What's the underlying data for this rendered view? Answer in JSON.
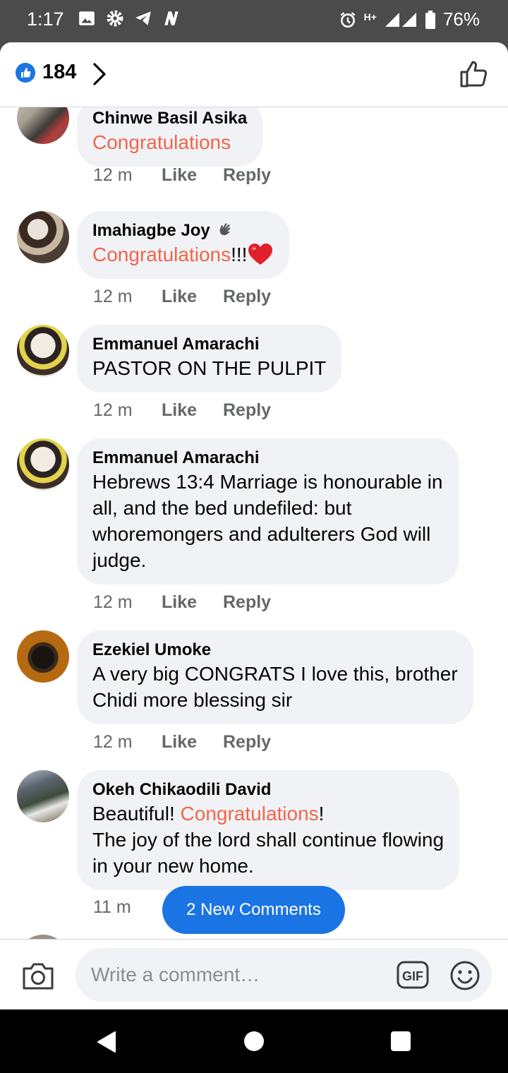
{
  "status_bar": {
    "time": "1:17",
    "network": "H+",
    "battery": "76%",
    "icons": [
      "image-icon",
      "gear-icon",
      "telegram-icon",
      "n-app-icon",
      "alarm-icon",
      "signal-icon",
      "battery-icon"
    ]
  },
  "header": {
    "reaction_count": "184",
    "icons": [
      "like-reaction-icon",
      "chevron-right-icon",
      "thumbs-up-outline-icon"
    ]
  },
  "comments": [
    {
      "author": "Chinwe Basil Asika",
      "segments": [
        {
          "text": "Congratulations",
          "highlight": true
        }
      ],
      "time": "12 m",
      "like": "Like",
      "reply": "Reply"
    },
    {
      "author": "Imahiagbe Joy",
      "author_badge": "wave-icon",
      "segments": [
        {
          "text": "Congratulations",
          "highlight": true
        },
        {
          "text": "!!!",
          "highlight": false
        }
      ],
      "emoji": "heart-icon",
      "time": "12 m",
      "like": "Like",
      "reply": "Reply"
    },
    {
      "author": "Emmanuel Amarachi",
      "segments": [
        {
          "text": "PASTOR ON THE PULPIT",
          "highlight": false
        }
      ],
      "time": "12 m",
      "like": "Like",
      "reply": "Reply"
    },
    {
      "author": "Emmanuel Amarachi",
      "lines": [
        "Hebrews  13:4 Marriage is honourable in",
        "all, and the bed undefiled: but",
        "whoremongers and adulterers God will",
        "judge."
      ],
      "time": "12 m",
      "like": "Like",
      "reply": "Reply"
    },
    {
      "author": "Ezekiel Umoke",
      "lines": [
        "A very big CONGRATS I love this,  brother",
        "Chidi more blessing sir"
      ],
      "time": "12 m",
      "like": "Like",
      "reply": "Reply"
    },
    {
      "author": "Okeh Chikaodili David",
      "line1_segments": [
        {
          "text": "Beautiful! ",
          "highlight": false
        },
        {
          "text": "Congratulations",
          "highlight": true
        },
        {
          "text": "!",
          "highlight": false
        }
      ],
      "lines": [
        "The joy of the lord shall continue flowing",
        "in your new home."
      ],
      "time": "11 m"
    }
  ],
  "new_comments_button": "2 New Comments",
  "composer": {
    "placeholder": "Write a comment…",
    "gif_label": "GIF",
    "icons": [
      "camera-icon",
      "gif-icon",
      "emoji-icon"
    ]
  },
  "nav_bar": {
    "icons": [
      "back-icon",
      "home-icon",
      "recents-icon"
    ]
  },
  "colors": {
    "accent_blue": "#1b74e4",
    "highlight_text": "#f0654b",
    "bubble": "#f0f2f5",
    "meta_text": "#65676b"
  }
}
